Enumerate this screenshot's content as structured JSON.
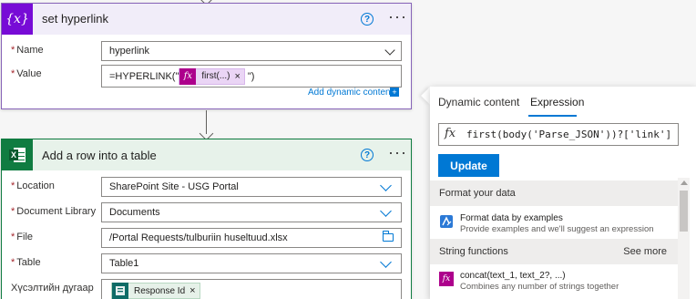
{
  "card_set_hyperlink": {
    "title": "set hyperlink",
    "icon": "variable-icon",
    "name_label": "Name",
    "name_value": "hyperlink",
    "value_label": "Value",
    "value_prefix": "=HYPERLINK(\"",
    "value_token": "first(...)",
    "value_suffix": "\")",
    "add_dynamic": "Add dynamic content",
    "accent": "#770bd6"
  },
  "card_add_row": {
    "title": "Add a row into a table",
    "icon": "excel-icon",
    "accent": "#107c41",
    "fields": {
      "location_label": "Location",
      "location_value": "SharePoint Site - USG Portal",
      "library_label": "Document Library",
      "library_value": "Documents",
      "file_label": "File",
      "file_value": "/Portal Requests/tulburiin huseltuud.xlsx",
      "table_label": "Table",
      "table_value": "Table1",
      "extra_label": "Хүсэлтийн дугаар",
      "extra_token": "Response Id"
    }
  },
  "panel": {
    "tab_dynamic": "Dynamic content",
    "tab_expression": "Expression",
    "active_tab": "Expression",
    "expression": "first(body('Parse_JSON'))?['link']",
    "update_label": "Update",
    "section_format": "Format your data",
    "format_item": {
      "name": "Format data by examples",
      "desc": "Provide examples and we'll suggest an expression"
    },
    "section_string": "String functions",
    "see_more": "See more",
    "string_item": {
      "name": "concat(text_1, text_2?, ...)",
      "desc": "Combines any number of strings together"
    }
  },
  "symbols": {
    "help": "?",
    "more": "···",
    "close": "×",
    "fx": "fx",
    "variable": "{x}",
    "excel_x": "X",
    "plus": "+"
  }
}
